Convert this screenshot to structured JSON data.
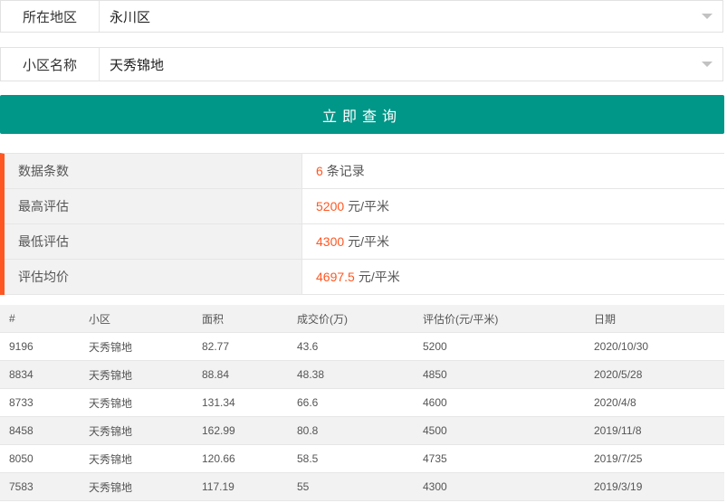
{
  "form": {
    "area": {
      "label": "所在地区",
      "value": "永川区"
    },
    "community": {
      "label": "小区名称",
      "value": "天秀锦地"
    },
    "query_button": "立即查询"
  },
  "summary": [
    {
      "key": "数据条数",
      "num": "6",
      "unit": "条记录"
    },
    {
      "key": "最高评估",
      "num": "5200",
      "unit": "元/平米"
    },
    {
      "key": "最低评估",
      "num": "4300",
      "unit": "元/平米"
    },
    {
      "key": "评估均价",
      "num": "4697.5",
      "unit": "元/平米"
    }
  ],
  "colors": {
    "accent": "#009688",
    "highlight": "#ff5722"
  },
  "table": {
    "headers": [
      "#",
      "小区",
      "面积",
      "成交价(万)",
      "评估价(元/平米)",
      "日期"
    ],
    "rows": [
      [
        "9196",
        "天秀锦地",
        "82.77",
        "43.6",
        "5200",
        "2020/10/30"
      ],
      [
        "8834",
        "天秀锦地",
        "88.84",
        "48.38",
        "4850",
        "2020/5/28"
      ],
      [
        "8733",
        "天秀锦地",
        "131.34",
        "66.6",
        "4600",
        "2020/4/8"
      ],
      [
        "8458",
        "天秀锦地",
        "162.99",
        "80.8",
        "4500",
        "2019/11/8"
      ],
      [
        "8050",
        "天秀锦地",
        "120.66",
        "58.5",
        "4735",
        "2019/7/25"
      ],
      [
        "7583",
        "天秀锦地",
        "117.19",
        "55",
        "4300",
        "2019/3/19"
      ]
    ]
  }
}
